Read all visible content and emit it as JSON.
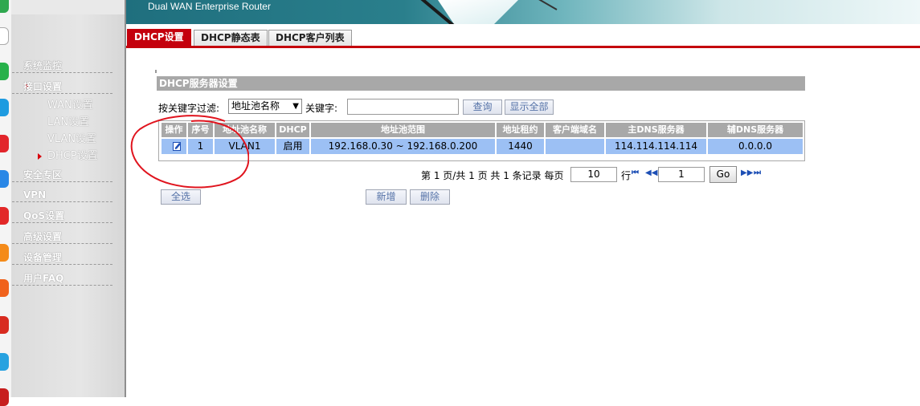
{
  "banner": {
    "title": "Dual WAN Enterprise Router"
  },
  "tabs": [
    {
      "label": "DHCP设置",
      "active": true
    },
    {
      "label": "DHCP静态表",
      "active": false
    },
    {
      "label": "DHCP客户列表",
      "active": false
    }
  ],
  "sidebar": {
    "items": [
      {
        "label": "系统监控"
      },
      {
        "label": "接口设置",
        "expanded": true,
        "children": [
          {
            "label": "WAN设置"
          },
          {
            "label": "LAN设置"
          },
          {
            "label": "VLAN设置"
          },
          {
            "label": "DHCP设置",
            "selected": true
          }
        ]
      },
      {
        "label": "安全专区"
      },
      {
        "label": "VPN"
      },
      {
        "label": "QoS设置"
      },
      {
        "label": "高级设置"
      },
      {
        "label": "设备管理"
      },
      {
        "label": "用户FAQ"
      }
    ]
  },
  "section": {
    "title": "DHCP服务器设置"
  },
  "filter": {
    "label": "按关键字过滤:",
    "selected_field": "地址池名称",
    "keyword_label": "关键字:",
    "keyword_value": "",
    "search_label": "查询",
    "show_all_label": "显示全部"
  },
  "table": {
    "headers": [
      "操作",
      "序号",
      "地址池名称",
      "DHCP",
      "地址池范围",
      "地址租约",
      "客户端域名",
      "主DNS服务器",
      "辅DNS服务器"
    ],
    "rows": [
      {
        "index": "1",
        "pool_name": "VLAN1",
        "dhcp": "启用",
        "range": "192.168.0.30 ~ 192.168.0.200",
        "lease": "1440",
        "domain": "",
        "dns1": "114.114.114.114",
        "dns2": "0.0.0.0"
      }
    ]
  },
  "pager": {
    "summary": "第 1 页/共 1 页 共 1 条记录 每页",
    "per_page": "10",
    "rows_label": "行",
    "page": "1",
    "go_label": "Go"
  },
  "actions": {
    "select_all": "全选",
    "add": "新增",
    "delete": "删除"
  },
  "colors": {
    "accent": "#c4000c",
    "header_gray": "#a8a8a8",
    "row_selected": "#9cc0f4",
    "link_blue": "#5673a8"
  }
}
